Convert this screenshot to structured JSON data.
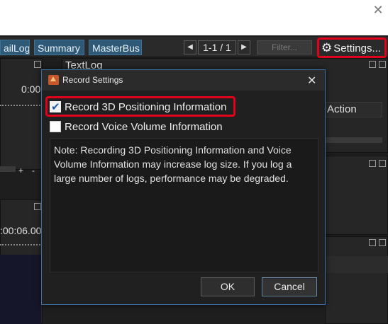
{
  "window": {
    "close_glyph": "✕"
  },
  "toolbar": {
    "tabs": [
      "ailLog",
      "Summary",
      "MasterBus"
    ],
    "pager": {
      "prev": "◀",
      "text": "1-1 / 1",
      "next": "▶"
    },
    "filter_label": "Filter...",
    "settings_label": "Settings..."
  },
  "panels": {
    "textlog_title": "TextLog",
    "action_col": "Action",
    "time_top": "0:00",
    "time_bottom": ":00:06.00",
    "zoom_minus": "-",
    "zoom_plus": "+"
  },
  "dialog": {
    "title": "Record Settings",
    "close_glyph": "✕",
    "options": [
      {
        "label": "Record 3D Positioning Information",
        "checked": true
      },
      {
        "label": "Record Voice Volume Information",
        "checked": false
      }
    ],
    "note": "Note: Recording 3D Positioning Information and Voice Volume Information may increase log size. If you log a large number of logs, performance may be degraded.",
    "ok_label": "OK",
    "cancel_label": "Cancel"
  },
  "colors": {
    "highlight": "#e3001b",
    "tab_bg": "#2e5a78",
    "accent_border": "#3a6ea5"
  },
  "icons": [
    "close-icon",
    "gear-icon",
    "chevron-left-icon",
    "chevron-right-icon",
    "float-window-icon",
    "app-icon",
    "checkbox-checked-icon",
    "checkbox-unchecked-icon"
  ]
}
